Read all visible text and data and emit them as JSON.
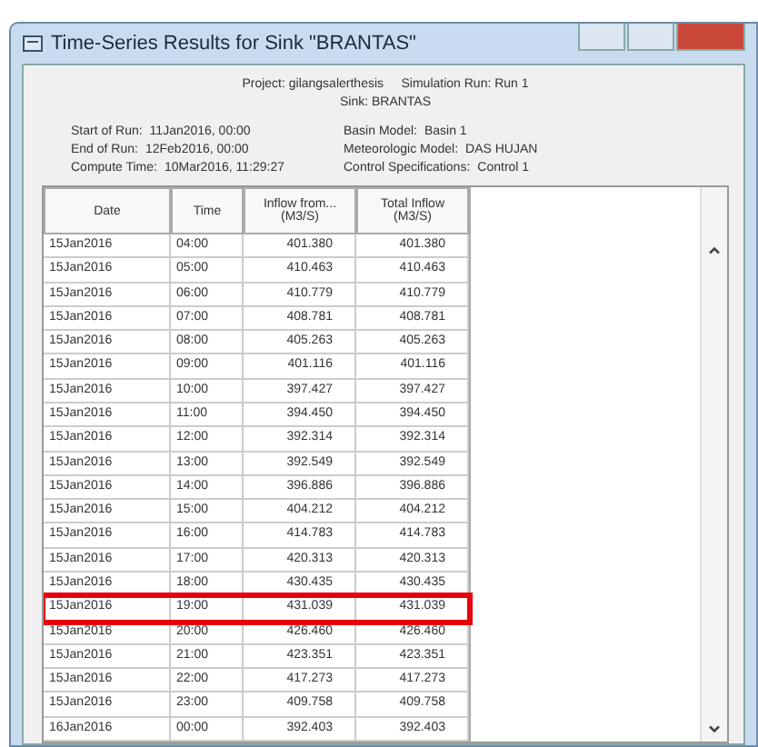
{
  "window": {
    "title": "Time-Series Results for Sink \"BRANTAS\""
  },
  "header": {
    "project_line": "Project: gilangsalerthesis     Simulation Run: Run 1",
    "sink_line": "Sink: BRANTAS"
  },
  "info": [
    {
      "label": "Start of Run:",
      "value": "11Jan2016, 00:00"
    },
    {
      "label": "Basin Model:",
      "value": "Basin 1"
    },
    {
      "label": "End of Run:",
      "value": "12Feb2016, 00:00"
    },
    {
      "label": "Meteorologic Model:",
      "value": "DAS HUJAN"
    },
    {
      "label": "Compute Time:",
      "value": "10Mar2016, 11:29:27"
    },
    {
      "label": "Control Specifications:",
      "value": "Control 1"
    }
  ],
  "table": {
    "columns": [
      {
        "title": "Date"
      },
      {
        "title": "Time"
      },
      {
        "title": "Inflow from...",
        "unit": "(M3/S)"
      },
      {
        "title": "Total Inflow",
        "unit": "(M3/S)"
      }
    ],
    "rows": [
      {
        "cells": [
          "15Jan2016",
          "04:00",
          "401.380",
          "401.380"
        ],
        "highlighted": false
      },
      {
        "cells": [
          "15Jan2016",
          "05:00",
          "410.463",
          "410.463"
        ],
        "highlighted": false
      },
      {
        "cells": [
          "15Jan2016",
          "06:00",
          "410.779",
          "410.779"
        ],
        "highlighted": false
      },
      {
        "cells": [
          "15Jan2016",
          "07:00",
          "408.781",
          "408.781"
        ],
        "highlighted": false
      },
      {
        "cells": [
          "15Jan2016",
          "08:00",
          "405.263",
          "405.263"
        ],
        "highlighted": false
      },
      {
        "cells": [
          "15Jan2016",
          "09:00",
          "401.116",
          "401.116"
        ],
        "highlighted": false
      },
      {
        "cells": [
          "15Jan2016",
          "10:00",
          "397.427",
          "397.427"
        ],
        "highlighted": false
      },
      {
        "cells": [
          "15Jan2016",
          "11:00",
          "394.450",
          "394.450"
        ],
        "highlighted": false
      },
      {
        "cells": [
          "15Jan2016",
          "12:00",
          "392.314",
          "392.314"
        ],
        "highlighted": false
      },
      {
        "cells": [
          "15Jan2016",
          "13:00",
          "392.549",
          "392.549"
        ],
        "highlighted": false
      },
      {
        "cells": [
          "15Jan2016",
          "14:00",
          "396.886",
          "396.886"
        ],
        "highlighted": false
      },
      {
        "cells": [
          "15Jan2016",
          "15:00",
          "404.212",
          "404.212"
        ],
        "highlighted": false
      },
      {
        "cells": [
          "15Jan2016",
          "16:00",
          "414.783",
          "414.783"
        ],
        "highlighted": false
      },
      {
        "cells": [
          "15Jan2016",
          "17:00",
          "420.313",
          "420.313"
        ],
        "highlighted": false
      },
      {
        "cells": [
          "15Jan2016",
          "18:00",
          "430.435",
          "430.435"
        ],
        "highlighted": false
      },
      {
        "cells": [
          "15Jan2016",
          "19:00",
          "431.039",
          "431.039"
        ],
        "highlighted": true
      },
      {
        "cells": [
          "15Jan2016",
          "20:00",
          "426.460",
          "426.460"
        ],
        "highlighted": false
      },
      {
        "cells": [
          "15Jan2016",
          "21:00",
          "423.351",
          "423.351"
        ],
        "highlighted": false
      },
      {
        "cells": [
          "15Jan2016",
          "22:00",
          "417.273",
          "417.273"
        ],
        "highlighted": false
      },
      {
        "cells": [
          "15Jan2016",
          "23:00",
          "409.758",
          "409.758"
        ],
        "highlighted": false
      },
      {
        "cells": [
          "16Jan2016",
          "00:00",
          "392.403",
          "392.403"
        ],
        "highlighted": false
      }
    ]
  }
}
